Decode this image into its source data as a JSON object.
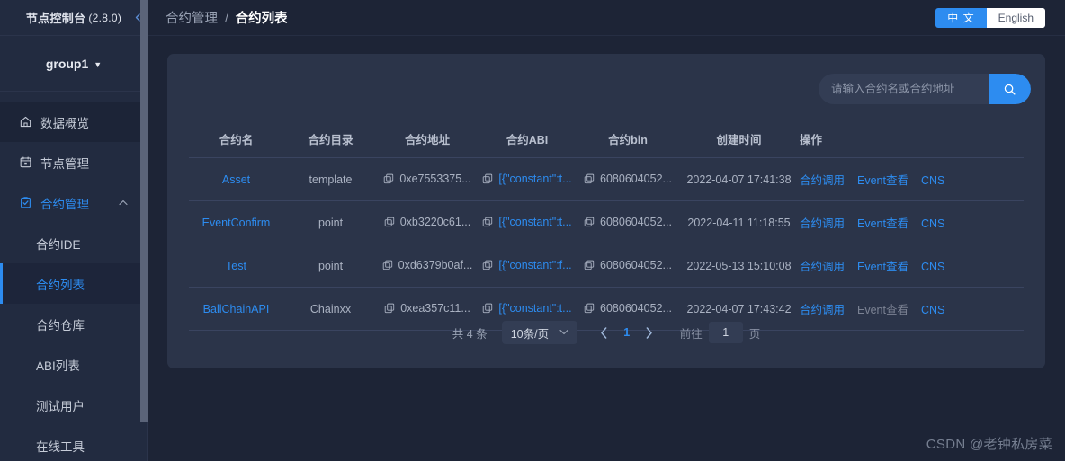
{
  "sidebar": {
    "brand": "节点控制台",
    "version": "(2.8.0)",
    "collapse_icon": "collapse-left-icon",
    "group": {
      "label": "group1",
      "caret": "▼"
    },
    "items": [
      {
        "label": "数据概览",
        "icon": "home-icon"
      },
      {
        "label": "节点管理",
        "icon": "calendar-node-icon"
      },
      {
        "label": "合约管理",
        "icon": "clipboard-check-icon",
        "chevron": "⌃"
      }
    ],
    "submenu": [
      {
        "label": "合约IDE"
      },
      {
        "label": "合约列表"
      },
      {
        "label": "合约仓库"
      },
      {
        "label": "ABI列表"
      },
      {
        "label": "测试用户"
      },
      {
        "label": "在线工具"
      }
    ],
    "active_item": "合约管理",
    "active_sub": "合约列表"
  },
  "header": {
    "breadcrumb_parent": "合约管理",
    "breadcrumb_sep": "/",
    "breadcrumb_current": "合约列表",
    "lang": {
      "zh": "中 文",
      "en": "English",
      "active": "zh"
    }
  },
  "search": {
    "placeholder": "请输入合约名或合约地址",
    "value": "",
    "button_icon": "search-icon"
  },
  "table": {
    "columns": [
      "合约名",
      "合约目录",
      "合约地址",
      "合约ABI",
      "合约bin",
      "创建时间",
      "操作"
    ],
    "rows": [
      {
        "name": "Asset",
        "dir": "template",
        "address": "0xe7553375...",
        "abi": "[{\"constant\":t...",
        "bin": "6080604052...",
        "created": "2022-04-07 17:41:38",
        "ops": [
          {
            "label": "合约调用",
            "disabled": false
          },
          {
            "label": "Event查看",
            "disabled": false
          },
          {
            "label": "CNS",
            "disabled": false
          }
        ]
      },
      {
        "name": "EventConfirm",
        "dir": "point",
        "address": "0xb3220c61...",
        "abi": "[{\"constant\":t...",
        "bin": "6080604052...",
        "created": "2022-04-11 11:18:55",
        "ops": [
          {
            "label": "合约调用",
            "disabled": false
          },
          {
            "label": "Event查看",
            "disabled": false
          },
          {
            "label": "CNS",
            "disabled": false
          }
        ]
      },
      {
        "name": "Test",
        "dir": "point",
        "address": "0xd6379b0af...",
        "abi": "[{\"constant\":f...",
        "bin": "6080604052...",
        "created": "2022-05-13 15:10:08",
        "ops": [
          {
            "label": "合约调用",
            "disabled": false
          },
          {
            "label": "Event查看",
            "disabled": false
          },
          {
            "label": "CNS",
            "disabled": false
          }
        ]
      },
      {
        "name": "BallChainAPI",
        "dir": "Chainxx",
        "address": "0xea357c11...",
        "abi": "[{\"constant\":t...",
        "bin": "6080604052...",
        "created": "2022-04-07 17:43:42",
        "ops": [
          {
            "label": "合约调用",
            "disabled": false
          },
          {
            "label": "Event查看",
            "disabled": true
          },
          {
            "label": "CNS",
            "disabled": false
          }
        ]
      }
    ]
  },
  "pagination": {
    "total_text": "共 4 条",
    "page_size": "10条/页",
    "prev_icon": "chevron-left-icon",
    "next_icon": "chevron-right-icon",
    "current_page": "1",
    "jump_prefix": "前往",
    "jump_value": "1",
    "jump_suffix": "页"
  },
  "watermark": "CSDN @老钟私房菜",
  "colors": {
    "accent": "#2d8cf0",
    "page_bg": "#1d2436",
    "sidebar_bg": "#222b40",
    "card_bg": "#2b3449",
    "row_border": "#3a4460",
    "muted_text": "#9aa3b5"
  }
}
